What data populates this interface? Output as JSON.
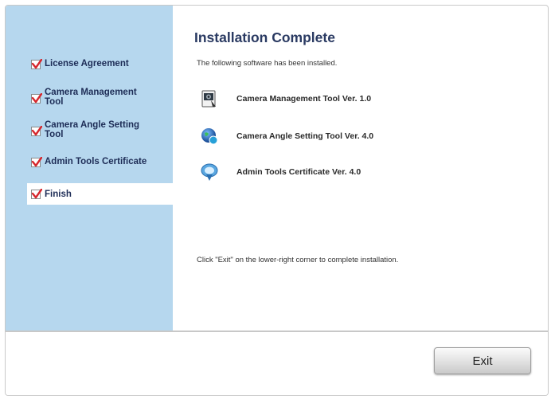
{
  "sidebar": {
    "steps": [
      {
        "label": "License Agreement",
        "checked": true,
        "active": false
      },
      {
        "label": "Camera Management Tool",
        "checked": true,
        "active": false
      },
      {
        "label": "Camera Angle Setting Tool",
        "checked": true,
        "active": false
      },
      {
        "label": "Admin Tools Certificate",
        "checked": true,
        "active": false
      },
      {
        "label": "Finish",
        "checked": true,
        "active": true
      }
    ]
  },
  "main": {
    "title": "Installation Complete",
    "subtitle": "The following software has been installed.",
    "software": [
      {
        "name": "Camera Management Tool Ver. 1.0",
        "icon": "camera-management-icon"
      },
      {
        "name": "Camera Angle Setting Tool Ver. 4.0",
        "icon": "globe-icon"
      },
      {
        "name": "Admin Tools Certificate Ver. 4.0",
        "icon": "certificate-icon"
      }
    ],
    "note": "Click \"Exit\" on the lower-right corner to complete installation."
  },
  "footer": {
    "exit_label": "Exit"
  },
  "colors": {
    "sidebar_bg": "#b6d7ee",
    "check_mark": "#d6262c",
    "title_text": "#2a3a62"
  }
}
